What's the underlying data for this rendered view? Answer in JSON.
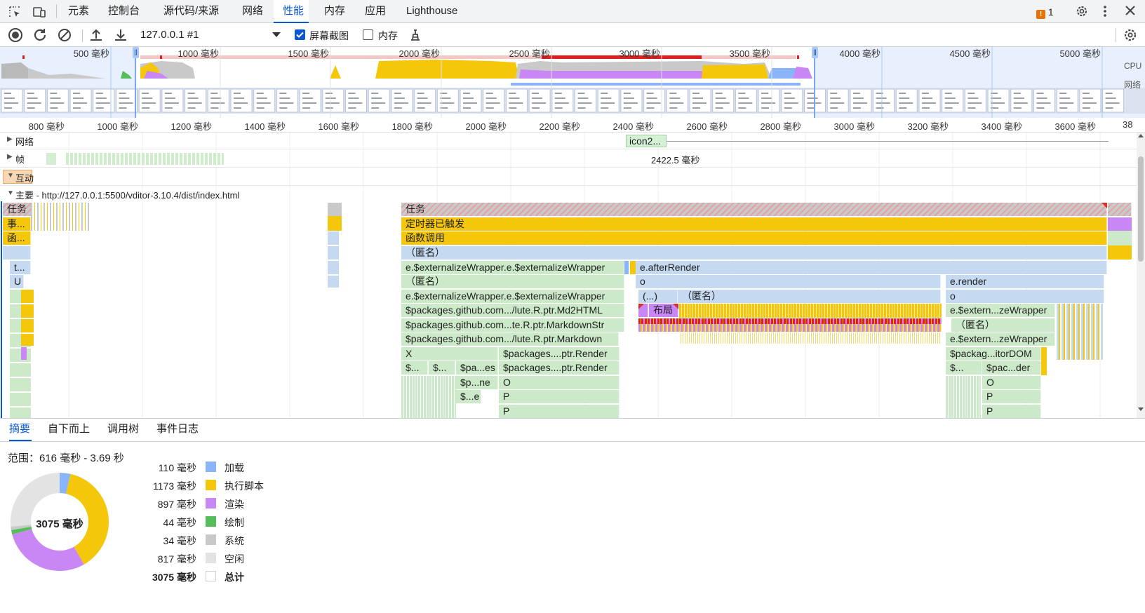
{
  "colors": {
    "accent": "#0b57d0",
    "loading": "#8ab4f8",
    "scripting": "#f4c70b",
    "rendering": "#c986f5",
    "painting": "#56bd5b",
    "system": "#c9c9c9",
    "idle": "#e3e3e3",
    "warning": "#e8710a",
    "long_task": "#d93025"
  },
  "tabs": [
    {
      "label": "元素"
    },
    {
      "label": "控制台"
    },
    {
      "label": "源代码/来源"
    },
    {
      "label": "网络"
    },
    {
      "label": "性能",
      "active": true
    },
    {
      "label": "内存"
    },
    {
      "label": "应用"
    },
    {
      "label": "Lighthouse"
    }
  ],
  "issues": {
    "count": "1"
  },
  "toolbar": {
    "recording_select": "127.0.0.1 #1",
    "screenshots_label": "屏幕截图",
    "screenshots_checked": true,
    "memory_label": "内存",
    "memory_checked": false
  },
  "overview": {
    "ticks": [
      "500 毫秒",
      "1000 毫秒",
      "1500 毫秒",
      "2000 毫秒",
      "2500 毫秒",
      "3000 毫秒",
      "3500 毫秒",
      "4000 毫秒",
      "4500 毫秒",
      "5000 毫秒"
    ],
    "cpu_label": "CPU",
    "network_label": "网络"
  },
  "ruler": {
    "ticks": [
      "800 毫秒",
      "1000 毫秒",
      "1200 毫秒",
      "1400 毫秒",
      "1600 毫秒",
      "1800 毫秒",
      "2000 毫秒",
      "2200 毫秒",
      "2400 毫秒",
      "2600 毫秒",
      "2800 毫秒",
      "3000 毫秒",
      "3200 毫秒",
      "3400 毫秒",
      "3600 毫秒",
      "38"
    ]
  },
  "tracks": {
    "network_label": "网络",
    "network_item": "icon2...",
    "frames_label": "帧",
    "frames_time": "2422.5 毫秒",
    "interactions_label": "互动",
    "main_label": "主要 - http://127.0.0.1:5500/vditor-3.10.4/dist/index.html"
  },
  "flame": {
    "left": [
      "任务",
      "事...",
      "函...",
      "t...",
      "U"
    ],
    "task": "任务",
    "timer": "定时器已触发",
    "func": "函数调用",
    "anon": "（匿名）",
    "col1": [
      "e.$externalizeWrapper.e.$externalizeWrapper",
      "（匿名）",
      "e.$externalizeWrapper.e.$externalizeWrapper",
      "$packages.github.com.../lute.R.ptr.Md2HTML",
      "$packages.github.com...te.R.ptr.MarkdownStr",
      "$packages.github.com.../lute.R.ptr.Markdown",
      "X",
      "$...",
      "$...",
      "$pa...es",
      "$p...ne",
      "$...e"
    ],
    "col1b": [
      "$packages....ptr.Render",
      "$packages....ptr.Render",
      "O",
      "P",
      "P"
    ],
    "col2": [
      "e.afterRender",
      "o",
      "(...)",
      "（匿名）",
      "布局"
    ],
    "col3": [
      "e.render",
      "o",
      "e.$extern...zeWrapper",
      "（匿名）",
      "e.$extern...zeWrapper",
      "$packag...itorDOM",
      "$...",
      "$pac...der",
      "O",
      "P",
      "P"
    ]
  },
  "bottom": {
    "tabs": [
      {
        "label": "摘要",
        "active": true
      },
      {
        "label": "自下而上"
      },
      {
        "label": "调用树"
      },
      {
        "label": "事件日志"
      }
    ],
    "range": "范围：616 毫秒 - 3.69 秒",
    "donut_total": "3075 毫秒",
    "legend": [
      {
        "value": "110 毫秒",
        "label": "加载",
        "color": "#8ab4f8"
      },
      {
        "value": "1173 毫秒",
        "label": "执行脚本",
        "color": "#f4c70b"
      },
      {
        "value": "897 毫秒",
        "label": "渲染",
        "color": "#c986f5"
      },
      {
        "value": "44 毫秒",
        "label": "绘制",
        "color": "#56bd5b"
      },
      {
        "value": "34 毫秒",
        "label": "系统",
        "color": "#c9c9c9"
      },
      {
        "value": "817 毫秒",
        "label": "空闲",
        "color": "#e3e3e3"
      },
      {
        "value": "3075 毫秒",
        "label": "总计",
        "color": "#ffffff",
        "bold": true
      }
    ]
  }
}
